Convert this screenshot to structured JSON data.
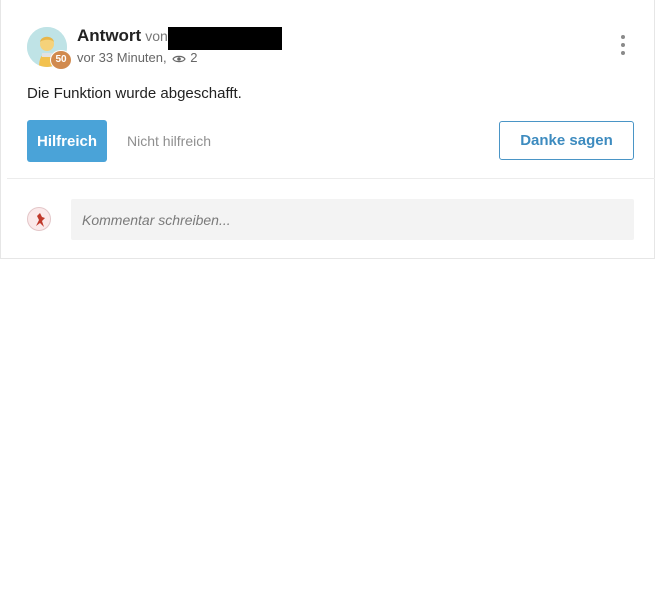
{
  "post": {
    "title": "Antwort",
    "by_label": "von",
    "time_label": "vor 33 Minuten,",
    "views": "2",
    "avatar_badge": "50",
    "content": "Die Funktion wurde abgeschafft."
  },
  "actions": {
    "helpful_label": "Hilfreich",
    "not_helpful_label": "Nicht hilfreich",
    "thanks_label": "Danke sagen"
  },
  "comment": {
    "placeholder": "Kommentar schreiben..."
  },
  "colors": {
    "accent": "#4aa3d8",
    "badge": "#d18a4e"
  },
  "icons": {
    "views": "eye-icon",
    "menu": "more-vertical-icon"
  }
}
